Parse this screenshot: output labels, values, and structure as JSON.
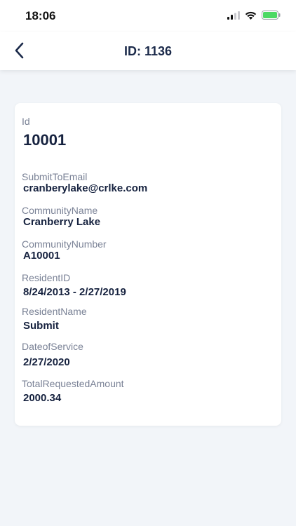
{
  "status": {
    "time": "18:06"
  },
  "header": {
    "title": "ID: 1136"
  },
  "fields": [
    {
      "label": "Id",
      "value": "10001"
    },
    {
      "label": "SubmitToEmail",
      "value": "cranberylake@crlke.com"
    },
    {
      "label": "CommunityName",
      "value": "Cranberry Lake"
    },
    {
      "label": "CommunityNumber",
      "value": "A10001"
    },
    {
      "label": "ResidentID",
      "value": "8/24/2013 - 2/27/2019"
    },
    {
      "label": "ResidentName",
      "value": "Submit"
    },
    {
      "label": "DateofService",
      "value": "2/27/2020"
    },
    {
      "label": "TotalRequestedAmount",
      "value": "2000.34"
    }
  ],
  "colors": {
    "accent": "#1b2a4a",
    "battery": "#4cd964",
    "background": "#f2f5f9"
  },
  "icons": [
    "signal-icon",
    "wifi-icon",
    "battery-icon",
    "back-chevron-icon"
  ]
}
